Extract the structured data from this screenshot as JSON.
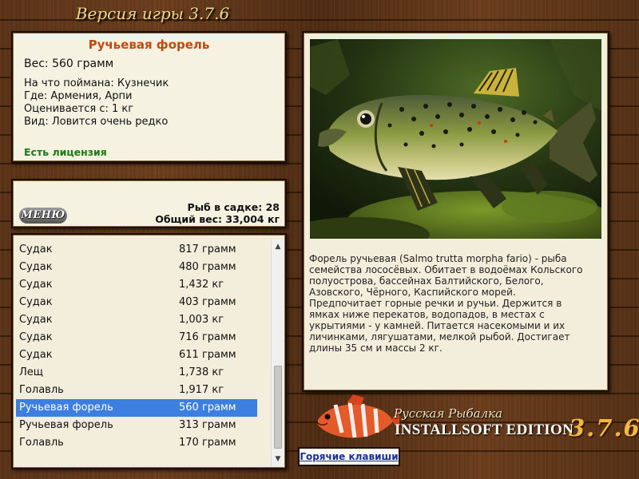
{
  "header": {
    "version_title": "Версия игры 3.7.6"
  },
  "fish_info": {
    "name": "Ручьевая форель",
    "weight": "Вес: 560 грамм",
    "caught_with": "На что поймана: Кузнечик",
    "location": "Где: Армения, Арпи",
    "rated_from": "Оценивается с: 1 кг",
    "rarity": "Вид: Ловится очень редко",
    "license": "Есть лицензия"
  },
  "stats": {
    "menu_label": "МЕНЮ",
    "fish_in_keepnet": "Рыб в садке: 28",
    "total_weight": "Общий вес: 33,004 кг"
  },
  "catch_list": {
    "rows": [
      {
        "name": "Судак",
        "weight": "817 грамм"
      },
      {
        "name": "Судак",
        "weight": "480 грамм"
      },
      {
        "name": "Судак",
        "weight": "1,432 кг"
      },
      {
        "name": "Судак",
        "weight": "403 грамм"
      },
      {
        "name": "Судак",
        "weight": "1,003 кг"
      },
      {
        "name": "Судак",
        "weight": "716 грамм"
      },
      {
        "name": "Судак",
        "weight": "611 грамм"
      },
      {
        "name": "Лещ",
        "weight": "1,738 кг"
      },
      {
        "name": "Голавль",
        "weight": "1,917 кг"
      },
      {
        "name": "Ручьевая форель",
        "weight": "560 грамм"
      },
      {
        "name": "Ручьевая форель",
        "weight": "313 грамм"
      },
      {
        "name": "Голавль",
        "weight": "170 грамм"
      }
    ],
    "selected_index": 9
  },
  "description": "Форель ручьевая (Salmo trutta morpha fario) - рыба семейства лососёвых. Обитает в водоёмах Кольского полуострова, бассейнах Балтийского, Белого, Азовского, Чёрного, Каспийского морей. Предпочитает горные речки и ручьи. Держится в ямках ниже перекатов, водопадов, в местах с укрытиями - у камней. Питается насекомыми и их личинками, лягушатами, мелкой рыбой. Достигает длины 35 см и массы 2 кг.",
  "branding": {
    "name": "Русская Рыбалка",
    "edition": "INSTALLSOFT EDITION",
    "version": "3.7.6"
  },
  "buttons": {
    "hotkeys": "Горячие клавиши"
  },
  "colors": {
    "fish_title": "#c04a10",
    "license_green": "#1a7a14",
    "selection_blue": "#3c7fe0",
    "version_gold": "#f0b842",
    "link_blue": "#1a2f9a"
  }
}
